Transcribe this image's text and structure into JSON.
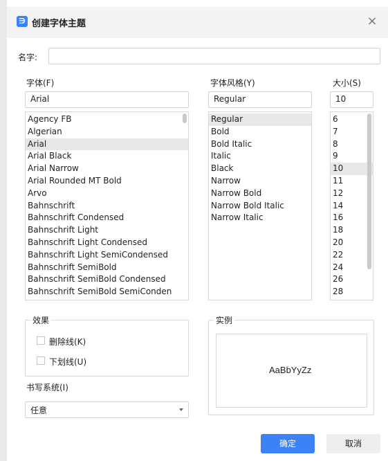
{
  "dialog": {
    "title": "创建字体主题",
    "app_icon_glyph": "∋",
    "close_glyph": "×"
  },
  "name_field": {
    "label": "名字:",
    "value": ""
  },
  "font": {
    "label": "字体(F)",
    "value": "Arial",
    "items": [
      "Agency FB",
      "Algerian",
      "Arial",
      "Arial Black",
      "Arial Narrow",
      "Arial Rounded MT Bold",
      "Arvo",
      "Bahnschrift",
      "Bahnschrift Condensed",
      "Bahnschrift Light",
      "Bahnschrift Light Condensed",
      "Bahnschrift Light SemiCondensed",
      "Bahnschrift SemiBold",
      "Bahnschrift SemiBold Condensed",
      "Bahnschrift SemiBold SemiConden"
    ],
    "selected": "Arial"
  },
  "style": {
    "label": "字体风格(Y)",
    "value": "Regular",
    "items": [
      "Regular",
      "Bold",
      "Bold Italic",
      "Italic",
      "Black",
      "Narrow",
      "Narrow Bold",
      "Narrow Bold Italic",
      "Narrow Italic"
    ],
    "selected": "Regular"
  },
  "size": {
    "label": "大小(S)",
    "value": "10",
    "items": [
      "6",
      "7",
      "8",
      "9",
      "10",
      "11",
      "12",
      "14",
      "16",
      "18",
      "20",
      "22",
      "24",
      "26",
      "28"
    ],
    "selected": "10"
  },
  "effects": {
    "title": "效果",
    "strikethrough": {
      "label": "删除线(K)",
      "checked": false
    },
    "underline": {
      "label": "下划线(U)",
      "checked": false
    }
  },
  "preview": {
    "title": "实例",
    "text": "AaBbYyZz"
  },
  "writing_system": {
    "label": "书写系统(I)",
    "value": "任意"
  },
  "buttons": {
    "ok": "确定",
    "cancel": "取消"
  },
  "colors": {
    "accent": "#3b82f6",
    "selection": "#e6e7e9"
  }
}
